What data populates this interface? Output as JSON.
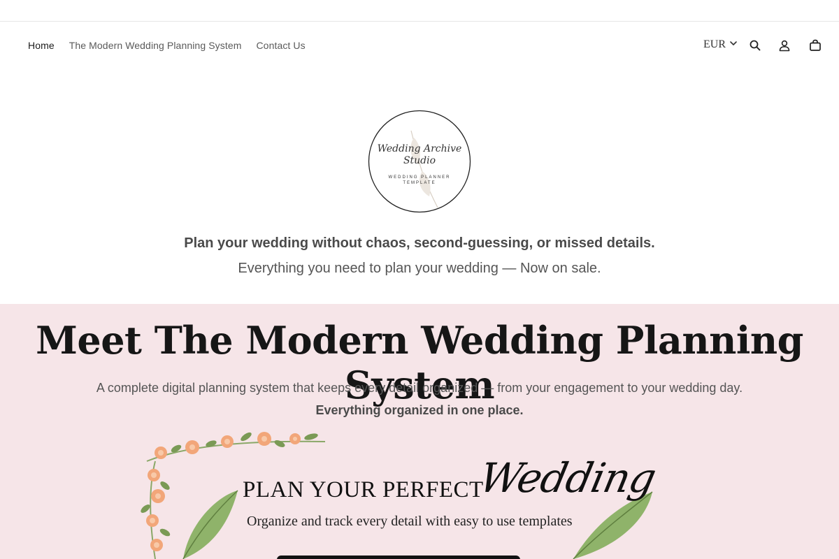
{
  "nav": {
    "items": [
      {
        "label": "Home",
        "active": true
      },
      {
        "label": "The Modern Wedding Planning System",
        "active": false
      },
      {
        "label": "Contact Us",
        "active": false
      }
    ]
  },
  "header_tools": {
    "currency": "EUR",
    "icons": [
      "search-icon",
      "account-icon",
      "cart-icon"
    ]
  },
  "logo": {
    "line1": "Wedding Archive",
    "line2": "Studio",
    "line3": "WEDDING PLANNER",
    "line4": "TEMPLATE"
  },
  "intro": {
    "headline": "Plan your wedding without chaos, second-guessing, or missed details.",
    "subline": "Everything you need to plan your wedding — Now on sale."
  },
  "feature": {
    "title": "Meet The Modern Wedding Planning System",
    "description": "A complete digital planning system that keeps every detail organized — from your engagement to your wedding day.",
    "description_bold": "Everything organized in one place."
  },
  "banner": {
    "headline": "PLAN YOUR PERFECT",
    "script": "Wedding",
    "tagline": "Organize and track every detail with easy to use templates"
  },
  "colors": {
    "feature_bg": "#f6e5e8",
    "text_dark": "#161616",
    "flower_peach": "#f2a679",
    "leaf_green": "#7a9a55"
  }
}
